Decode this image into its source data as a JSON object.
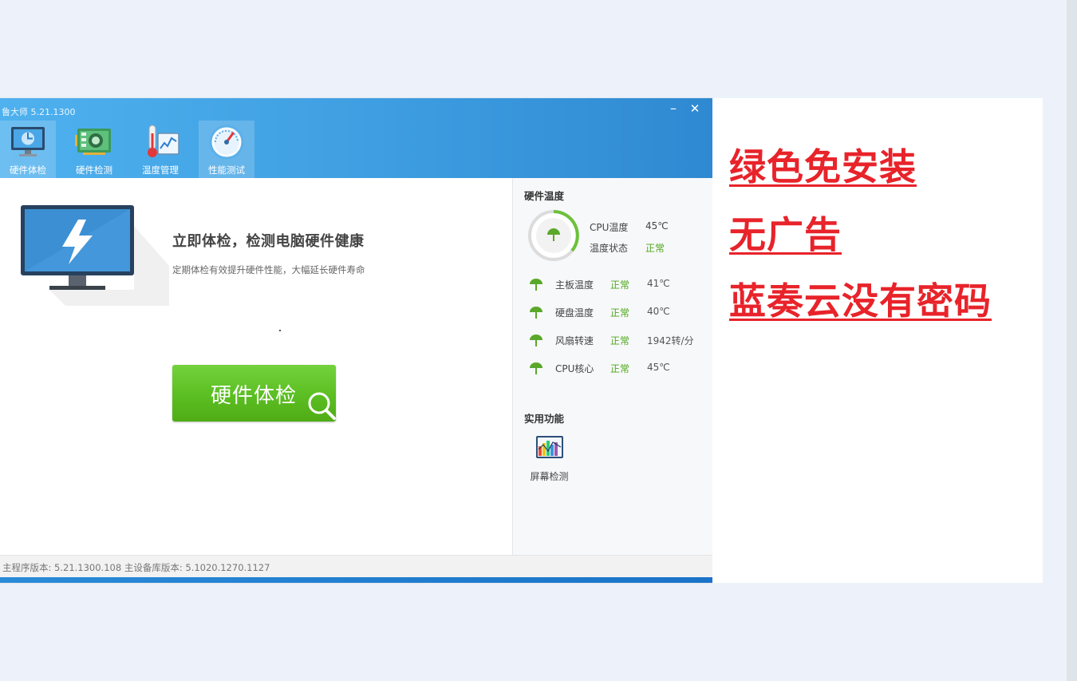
{
  "window": {
    "title": "鲁大师 5.21.1300",
    "minimize": "–",
    "close": "✕"
  },
  "nav": [
    {
      "label": "硬件体检",
      "icon": "monitor-icon",
      "active": true
    },
    {
      "label": "硬件检测",
      "icon": "circuit-board-icon",
      "active": false
    },
    {
      "label": "温度管理",
      "icon": "thermometer-chart-icon",
      "active": false
    },
    {
      "label": "性能测试",
      "icon": "speedometer-icon",
      "active": false
    }
  ],
  "main": {
    "headline": "立即体检，检测电脑硬件健康",
    "subline": "定期体检有效提升硬件性能，大幅延长硬件寿命",
    "check_button": "硬件体检"
  },
  "side": {
    "temp_title": "硬件温度",
    "cpu_temp_label": "CPU温度",
    "cpu_temp_value": "45℃",
    "temp_status_label": "温度状态",
    "temp_status_value": "正常",
    "rows": [
      {
        "name": "主板温度",
        "status": "正常",
        "value": "41℃"
      },
      {
        "name": "硬盘温度",
        "status": "正常",
        "value": "40℃"
      },
      {
        "name": "风扇转速",
        "status": "正常",
        "value": "1942转/分"
      },
      {
        "name": "CPU核心",
        "status": "正常",
        "value": "45℃"
      }
    ],
    "tools_title": "实用功能",
    "tool_label": "屏幕检测"
  },
  "footer": {
    "version": "主程序版本: 5.21.1300.108  主设备库版本: 5.1020.1270.1127"
  },
  "overlay": {
    "line1": "绿色免安装",
    "line2": "无广告",
    "line3": "蓝奏云没有密码",
    "color": "#e8232a"
  },
  "colors": {
    "header_blue": "#3f9fe2",
    "status_green": "#4da719",
    "button_green": "#5bbe22"
  }
}
